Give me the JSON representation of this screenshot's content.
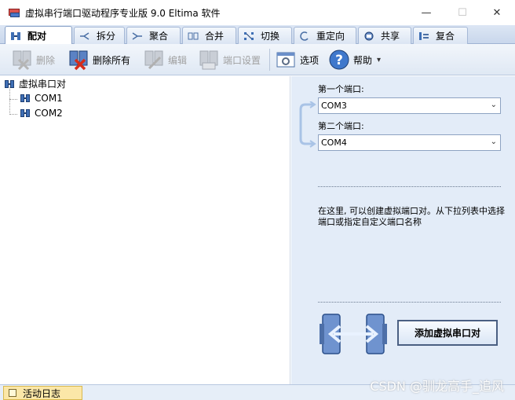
{
  "window": {
    "title": "虚拟串行端口驱动程序专业版 9.0 Eltima 软件",
    "min": "—",
    "max": "☐",
    "close": "✕"
  },
  "tabs": [
    {
      "label": "配对",
      "icon": "pair-icon",
      "active": true
    },
    {
      "label": "拆分",
      "icon": "split-icon"
    },
    {
      "label": "聚合",
      "icon": "aggregate-icon"
    },
    {
      "label": "合并",
      "icon": "merge-icon"
    },
    {
      "label": "切换",
      "icon": "switch-icon"
    },
    {
      "label": "重定向",
      "icon": "redirect-icon"
    },
    {
      "label": "共享",
      "icon": "share-icon"
    },
    {
      "label": "复合",
      "icon": "composite-icon"
    }
  ],
  "toolbar": {
    "delete": "删除",
    "delete_all": "删除所有",
    "edit": "编辑",
    "port_settings": "端口设置",
    "options": "选项",
    "help": "帮助",
    "help_arrow": "▾"
  },
  "tree": {
    "root": "虚拟串口对",
    "children": [
      "COM1",
      "COM2"
    ]
  },
  "panel": {
    "first_port_label": "第一个端口:",
    "first_port_value": "COM3",
    "second_port_label": "第二个端口:",
    "second_port_value": "COM4",
    "arrow": "⌄",
    "description": "在这里, 可以创建虚拟端口对。从下拉列表中选择端口或指定自定义端口名称",
    "add_button": "添加虚拟串口对"
  },
  "statusbar": {
    "log_tab": "活动日志"
  },
  "watermark": "CSDN @驯龙高手_追风"
}
